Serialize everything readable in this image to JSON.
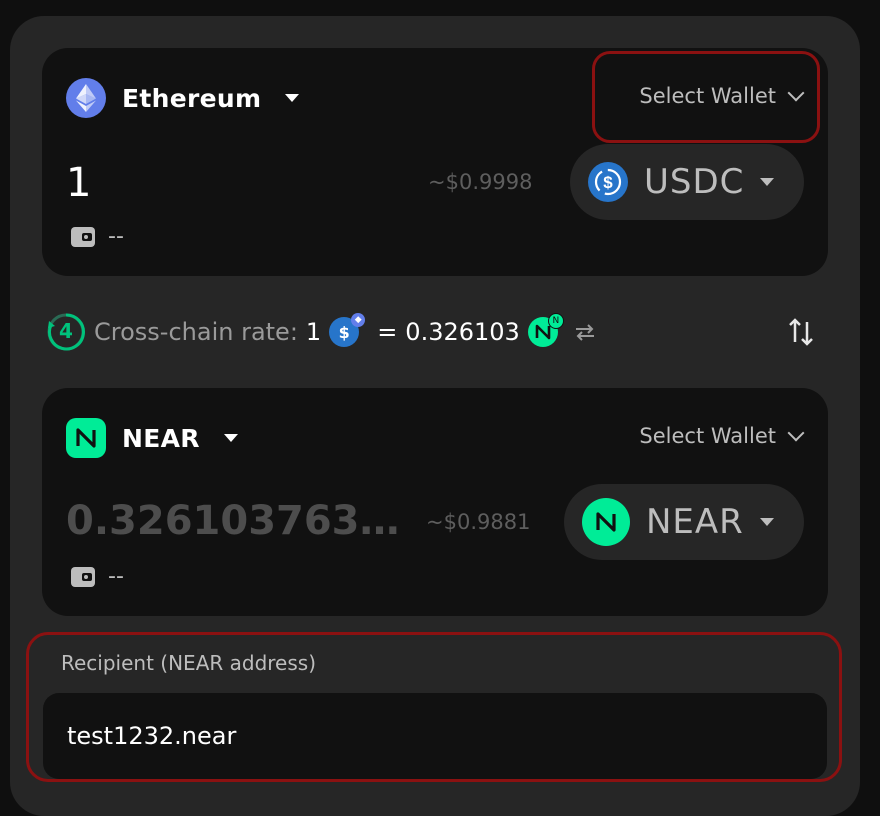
{
  "from": {
    "chain": "Ethereum",
    "wallet_label": "Select Wallet",
    "amount": "1",
    "usd_value": "~$0.9998",
    "token": "USDC",
    "balance": "--"
  },
  "rate": {
    "step_badge": "4",
    "label": "Cross-chain rate:",
    "from_amount": "1",
    "equals": "=",
    "to_amount": "0.326103"
  },
  "to": {
    "chain": "NEAR",
    "wallet_label": "Select Wallet",
    "amount": "0.3261037635...",
    "usd_value": "~$0.9881",
    "token": "NEAR",
    "balance": "--"
  },
  "recipient": {
    "label": "Recipient (NEAR address)",
    "value": "test1232.near"
  },
  "colors": {
    "panel": "#262626",
    "card": "#111111",
    "highlight": "#8b1111",
    "near_green": "#00ec97",
    "usdc_blue": "#2775ca",
    "eth_purple": "#627eea"
  }
}
